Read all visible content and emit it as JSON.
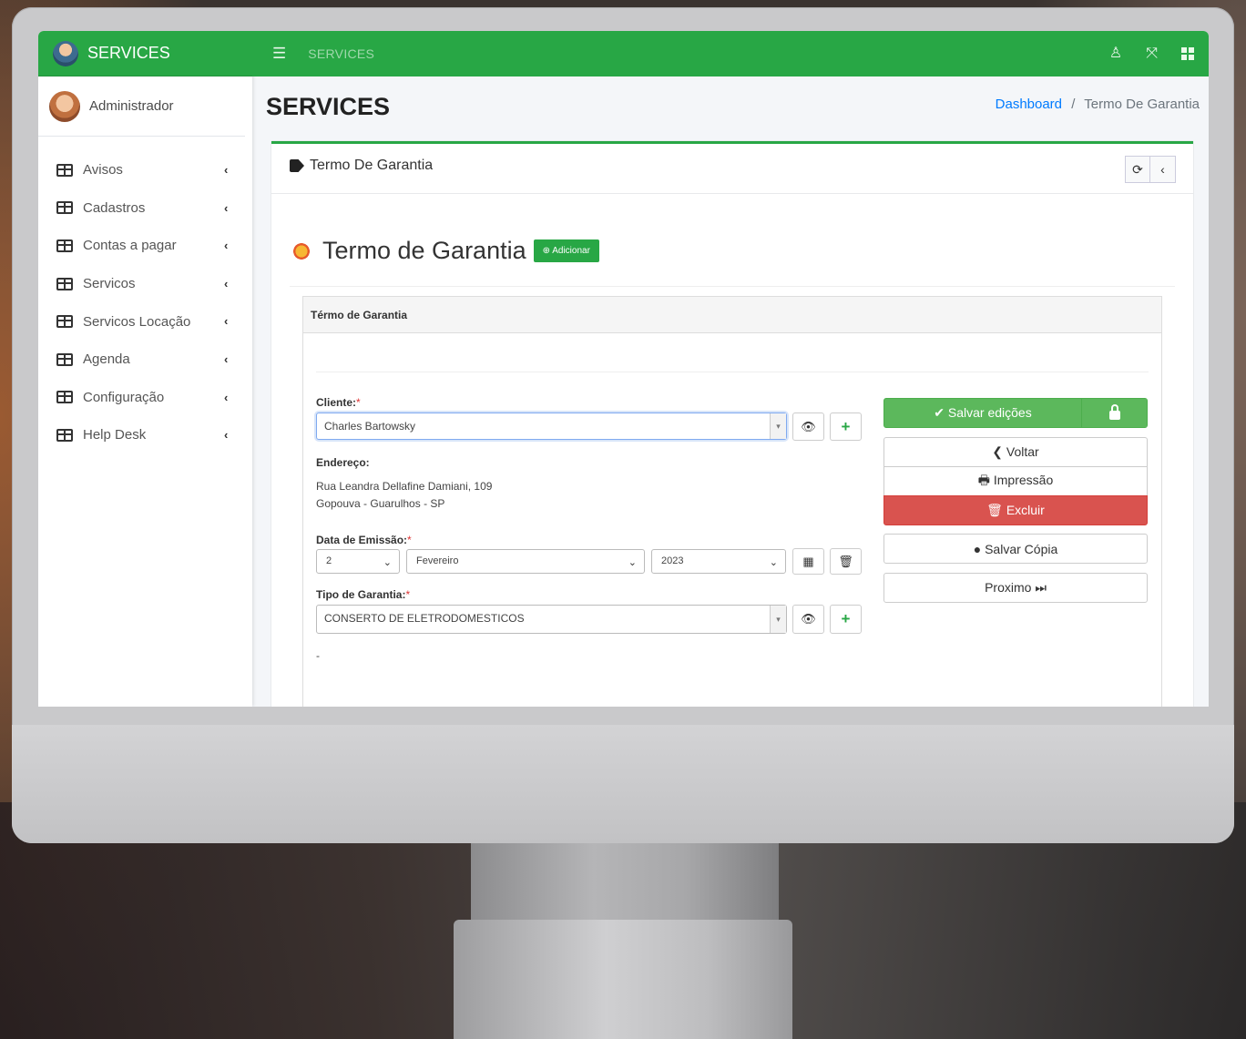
{
  "sidebar": {
    "brand": "SERVICES",
    "user": "Administrador",
    "items": [
      {
        "label": "Avisos"
      },
      {
        "label": "Cadastros"
      },
      {
        "label": "Contas a pagar"
      },
      {
        "label": "Servicos"
      },
      {
        "label": "Servicos Locação"
      },
      {
        "label": "Agenda"
      },
      {
        "label": "Configuração"
      },
      {
        "label": "Help Desk"
      }
    ]
  },
  "topbar": {
    "title": "SERVICES",
    "icons": [
      "hamburger-icon",
      "user-icon",
      "fullscreen-icon",
      "grid-icon"
    ]
  },
  "page": {
    "title": "SERVICES",
    "breadcrumb": {
      "home": "Dashboard",
      "separator": "/",
      "current": "Termo De Garantia"
    }
  },
  "card": {
    "title": "Termo De Garantia",
    "heading": "Termo de Garantia",
    "add_button": "Adicionar"
  },
  "form": {
    "panel_title": "Térmo de Garantia",
    "cliente_label": "Cliente:",
    "cliente_value": "Charles Bartowsky",
    "endereco_label": "Endereço:",
    "endereco_line1": "Rua Leandra Dellafine Damiani, 109",
    "endereco_line2": "Gopouva - Guarulhos - SP",
    "data_label": "Data de Emissão:",
    "dia": "2",
    "mes": "Fevereiro",
    "ano": "2023",
    "tipo_label": "Tipo de Garantia:",
    "tipo_value": "CONSERTO DE ELETRODOMESTICOS",
    "required_mark": "*",
    "trailing": "-"
  },
  "actions": {
    "salvar": "✔ Salvar edições",
    "voltar": "❮ Voltar",
    "impressao": "🖶 Impressão",
    "excluir": "🗑 Excluir",
    "salvar_copia": "● Salvar Cópia",
    "proximo": "Proximo ⏭"
  },
  "colors": {
    "primary_green": "#28a745",
    "save_green": "#5cb85c",
    "danger_red": "#d9534f",
    "link_blue": "#007bff"
  }
}
